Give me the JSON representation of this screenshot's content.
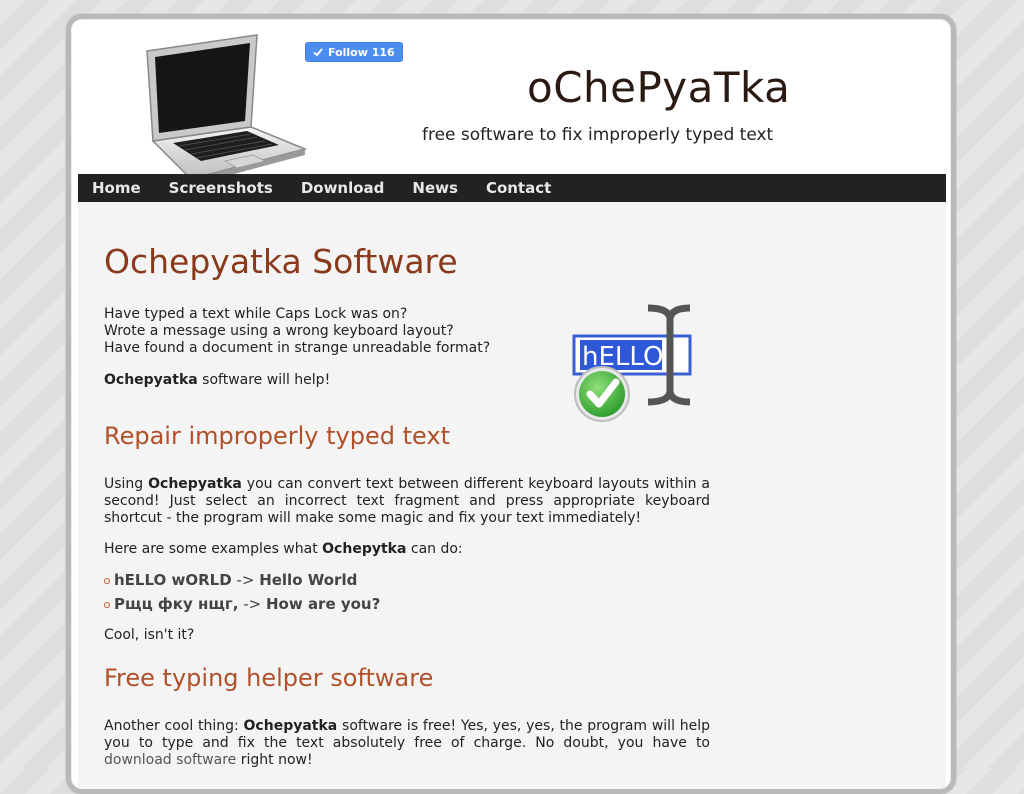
{
  "header": {
    "follow_label": "Follow 116",
    "site_title": "oChePyaTka",
    "tagline": "free software to fix improperly typed text"
  },
  "nav": {
    "items": [
      {
        "label": "Home"
      },
      {
        "label": "Screenshots"
      },
      {
        "label": "Download"
      },
      {
        "label": "News"
      },
      {
        "label": "Contact"
      }
    ]
  },
  "main": {
    "title": "Ochepyatka Software",
    "intro_line1": "Have typed a text while Caps Lock was on?",
    "intro_line2": "Wrote a message using a wrong keyboard layout?",
    "intro_line3": "Have found a document in strange unreadable format?",
    "help_bold": "Ochepyatka",
    "help_rest": " software will help!",
    "graphic_text": "hELLO",
    "section1": {
      "heading": "Repair improperly typed text",
      "p1_pre": "Using ",
      "p1_bold": "Ochepyatka",
      "p1_rest": " you can convert text between different keyboard layouts within a second! Just select an incorrect text fragment and press appropriate keyboard shortcut - the program will make some magic and fix your text immediately!",
      "p2_pre": "Here are some examples what ",
      "p2_bold": "Ochepytka",
      "p2_rest": " can do:",
      "examples": [
        {
          "from": "hELLO wORLD",
          "arrow": " -> ",
          "to": "Hello World"
        },
        {
          "from": "Рщц фку нщг,",
          "arrow": " -> ",
          "to": "How are you?"
        }
      ],
      "cool": "Cool, isn't it?"
    },
    "section2": {
      "heading": "Free typing helper software",
      "p_pre": "Another cool thing: ",
      "p_bold": "Ochepyatka",
      "p_mid": " software is free! Yes, yes, yes, the program will help you to type and fix the text absolutely free of charge. No doubt, you have to ",
      "p_link": "download software",
      "p_end": " right now!"
    }
  }
}
